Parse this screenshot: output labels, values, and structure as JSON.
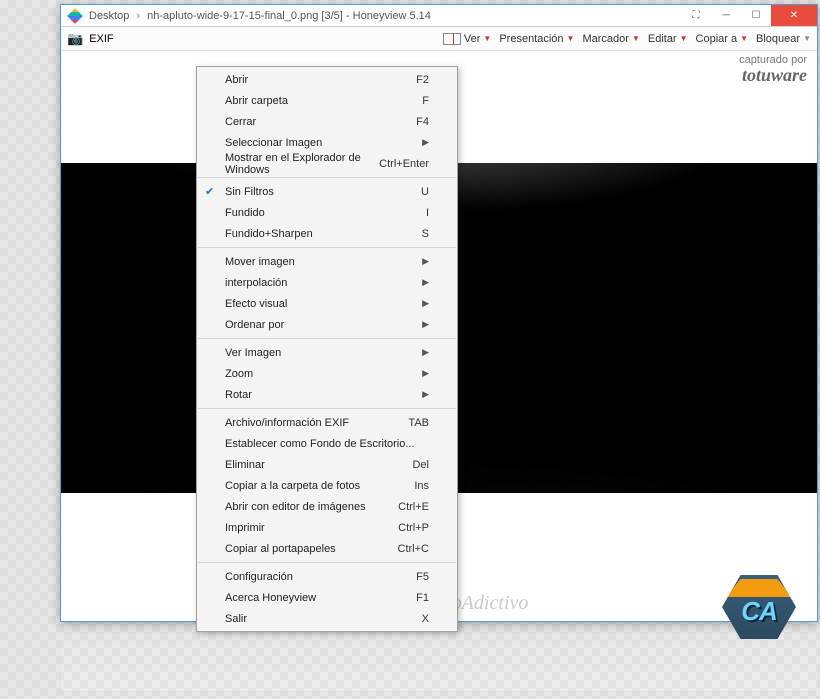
{
  "titlebar": {
    "path1": "Desktop",
    "path2": "nh-apluto-wide-9-17-15-final_0.png [3/5]",
    "app": "Honeyview 5.14"
  },
  "toolbar": {
    "exif": "EXIF",
    "ver": "Ver",
    "presentacion": "Presentación",
    "marcador": "Marcador",
    "editar": "Editar",
    "copiar": "Copiar a",
    "bloquear": "Bloquear"
  },
  "watermark": {
    "captured": "capturado por",
    "brand": "totuware",
    "bottom": "ConocimientoAdictivo"
  },
  "badge": {
    "text": "CA"
  },
  "menu": [
    {
      "type": "item",
      "label": "Abrir",
      "shortcut": "F2"
    },
    {
      "type": "item",
      "label": "Abrir carpeta",
      "shortcut": "F"
    },
    {
      "type": "item",
      "label": "Cerrar",
      "shortcut": "F4"
    },
    {
      "type": "item",
      "label": "Seleccionar Imagen",
      "submenu": true
    },
    {
      "type": "item",
      "label": "Mostrar en el Explorador de Windows",
      "shortcut": "Ctrl+Enter"
    },
    {
      "type": "sep"
    },
    {
      "type": "item",
      "label": "Sin Filtros",
      "shortcut": "U",
      "checked": true
    },
    {
      "type": "item",
      "label": "Fundido",
      "shortcut": "I"
    },
    {
      "type": "item",
      "label": "Fundido+Sharpen",
      "shortcut": "S"
    },
    {
      "type": "sep"
    },
    {
      "type": "item",
      "label": "Mover imagen",
      "submenu": true
    },
    {
      "type": "item",
      "label": "interpolación",
      "submenu": true
    },
    {
      "type": "item",
      "label": "Efecto visual",
      "submenu": true
    },
    {
      "type": "item",
      "label": "Ordenar por",
      "submenu": true
    },
    {
      "type": "sep"
    },
    {
      "type": "item",
      "label": "Ver Imagen",
      "submenu": true
    },
    {
      "type": "item",
      "label": "Zoom",
      "submenu": true
    },
    {
      "type": "item",
      "label": "Rotar",
      "submenu": true
    },
    {
      "type": "sep"
    },
    {
      "type": "item",
      "label": "Archivo/información EXIF",
      "shortcut": "TAB"
    },
    {
      "type": "item",
      "label": "Establecer como Fondo de Escritorio..."
    },
    {
      "type": "item",
      "label": "Eliminar",
      "shortcut": "Del"
    },
    {
      "type": "item",
      "label": "Copiar a la carpeta de fotos",
      "shortcut": "Ins"
    },
    {
      "type": "item",
      "label": "Abrir con editor de imágenes",
      "shortcut": "Ctrl+E"
    },
    {
      "type": "item",
      "label": "Imprimir",
      "shortcut": "Ctrl+P"
    },
    {
      "type": "item",
      "label": "Copiar al portapapeles",
      "shortcut": "Ctrl+C"
    },
    {
      "type": "sep"
    },
    {
      "type": "item",
      "label": "Configuración",
      "shortcut": "F5"
    },
    {
      "type": "item",
      "label": "Acerca Honeyview",
      "shortcut": "F1"
    },
    {
      "type": "item",
      "label": "Salir",
      "shortcut": "X"
    }
  ]
}
